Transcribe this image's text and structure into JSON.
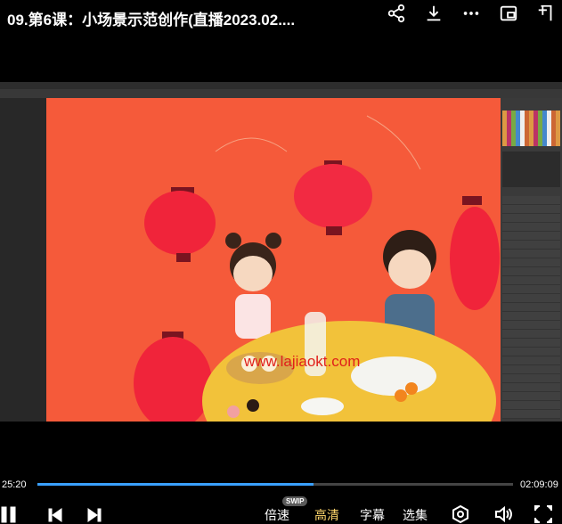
{
  "header": {
    "title": "09.第6课：小场景示范创作(直播2023.02...."
  },
  "icons": {
    "share": "share-icon",
    "download": "download-icon",
    "more": "more-icon",
    "pip": "picture-in-picture-icon",
    "screen": "screen-icon"
  },
  "video": {
    "watermark": "www.lajiaokt.com"
  },
  "player": {
    "current_time": "25:20",
    "duration": "02:09:09",
    "progress_fraction": 0.58,
    "swip_badge": "SWIP",
    "speed_label": "倍速",
    "quality_label": "高清",
    "subtitle_label": "字幕",
    "episodes_label": "选集"
  },
  "colors": {
    "accent": "#3aa0ff",
    "quality_active": "#ffd66b",
    "canvas_bg": "#f55a3a",
    "watermark": "#e0201a"
  }
}
